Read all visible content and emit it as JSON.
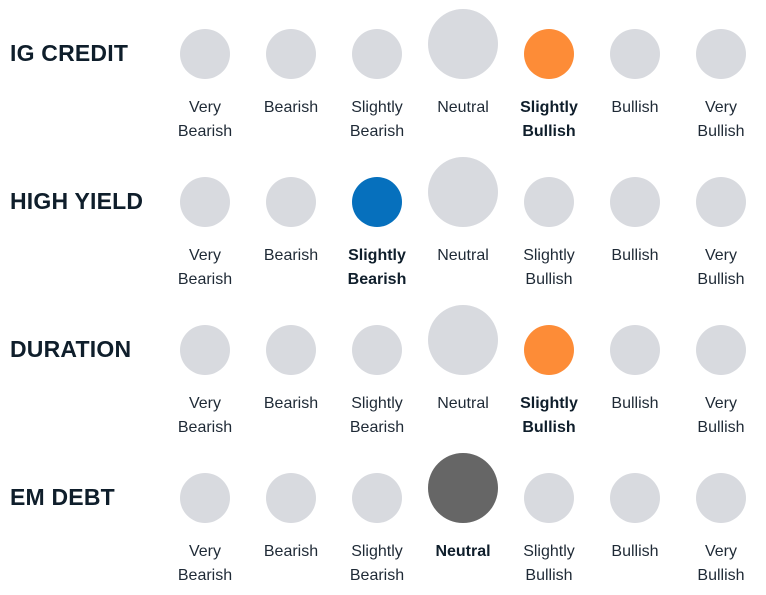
{
  "chart_data": {
    "type": "table",
    "title": "",
    "scale": [
      "Very Bearish",
      "Bearish",
      "Slightly Bearish",
      "Neutral",
      "Slightly Bullish",
      "Bullish",
      "Very Bullish"
    ],
    "scale_labels": [
      [
        "Very",
        "Bearish"
      ],
      [
        "Bearish",
        ""
      ],
      [
        "Slightly",
        "Bearish"
      ],
      [
        "Neutral",
        ""
      ],
      [
        "Slightly",
        "Bullish"
      ],
      [
        "Bullish",
        ""
      ],
      [
        "Very",
        "Bullish"
      ]
    ],
    "rows": [
      {
        "name": "IG CREDIT",
        "selected": "Slightly Bullish",
        "selected_index": 4,
        "color": "#fd8c37"
      },
      {
        "name": "HIGH YIELD",
        "selected": "Slightly Bearish",
        "selected_index": 2,
        "color": "#0670bd"
      },
      {
        "name": "DURATION",
        "selected": "Slightly Bullish",
        "selected_index": 4,
        "color": "#fd8c37"
      },
      {
        "name": "EM DEBT",
        "selected": "Neutral",
        "selected_index": 3,
        "color": "#666666"
      }
    ],
    "inactive_color": "#d8dadf"
  }
}
